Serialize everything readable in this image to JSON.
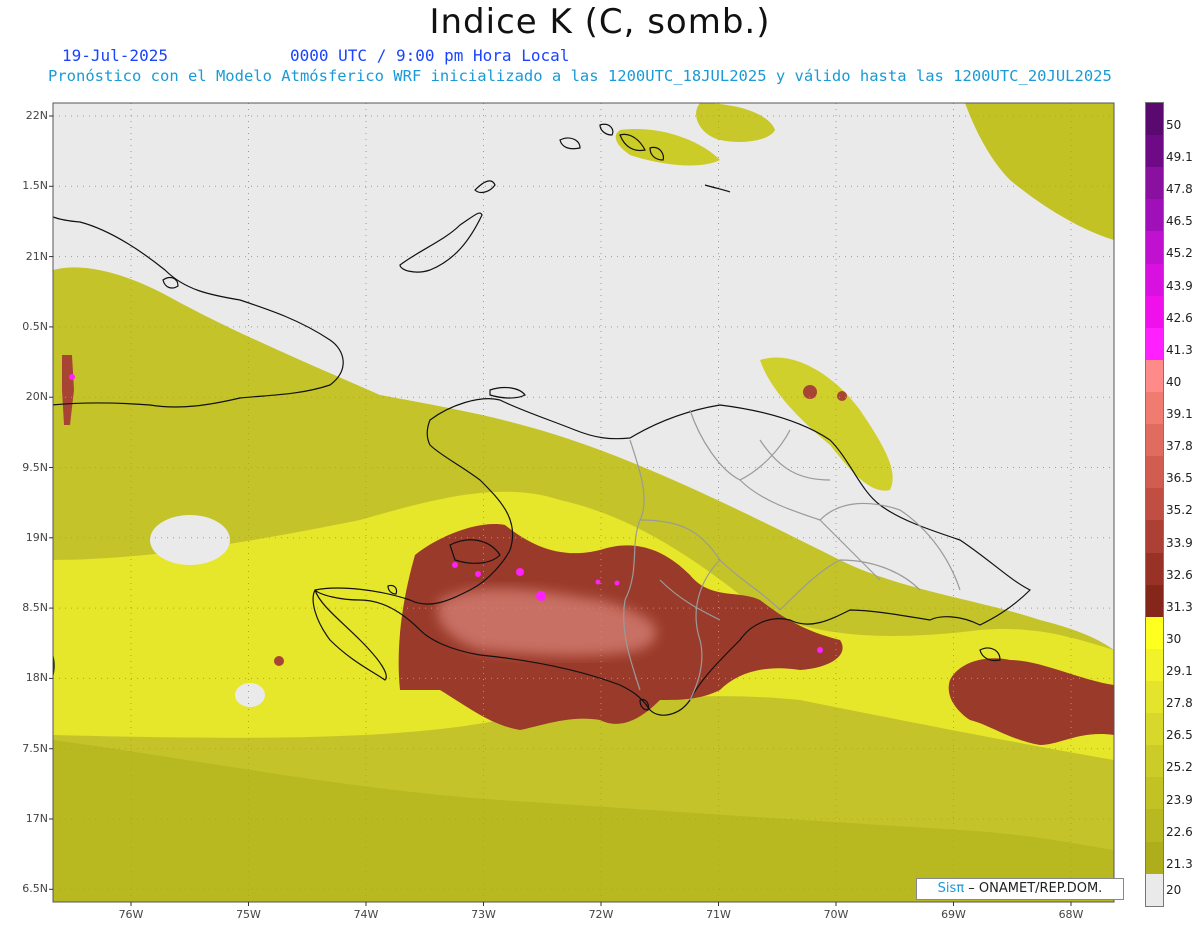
{
  "header": {
    "title": "Indice K (C, somb.)",
    "date": "19-Jul-2025",
    "valid_time": "0000 UTC / 9:00 pm Hora Local",
    "model_line": "Pronóstico con el Modelo Atmósferico WRF inicializado a las 1200UTC_18JUL2025 y válido hasta las  1200UTC_20JUL2025"
  },
  "axes": {
    "lat_labels": [
      "22N",
      "1.5N",
      "21N",
      "0.5N",
      "20N",
      "9.5N",
      "19N",
      "8.5N",
      "18N",
      "7.5N",
      "17N",
      "6.5N"
    ],
    "lon_labels": [
      "76W",
      "75W",
      "74W",
      "73W",
      "72W",
      "71W",
      "70W",
      "69W",
      "68W"
    ]
  },
  "legend": {
    "levels": [
      "50",
      "49.1",
      "47.8",
      "46.5",
      "45.2",
      "43.9",
      "42.6",
      "41.3",
      "40",
      "39.1",
      "37.8",
      "36.5",
      "35.2",
      "33.9",
      "32.6",
      "31.3",
      "30",
      "29.1",
      "27.8",
      "26.5",
      "25.2",
      "23.9",
      "22.6",
      "21.3",
      "20"
    ],
    "colors": [
      "#5a0a6e",
      "#6e0a86",
      "#8a10a0",
      "#a010b8",
      "#c010d0",
      "#d810e0",
      "#f010ec",
      "#ff20ff",
      "#ff8a8a",
      "#f07b70",
      "#e06c60",
      "#d05d50",
      "#c04e42",
      "#ac4034",
      "#983226",
      "#84261a",
      "#ffff20",
      "#f2f22a",
      "#e4e42c",
      "#d8d82c",
      "#cccc28",
      "#c2c224",
      "#b8b820",
      "#aeae1c",
      "#eaeaea"
    ]
  },
  "credit": {
    "prefix": "Sis",
    "symbol": "π",
    "suffix": "– ONAMET/REP.DOM."
  }
}
